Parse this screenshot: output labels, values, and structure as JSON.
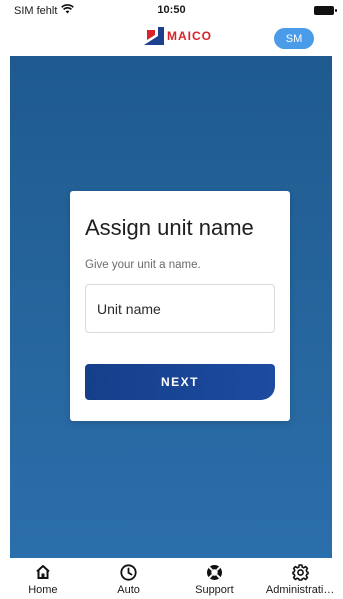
{
  "status_bar": {
    "carrier": "SIM fehlt",
    "time": "10:50"
  },
  "header": {
    "brand": "MAICO",
    "avatar_initials": "SM",
    "avatar_color": "#4a9be8",
    "brand_color": "#d8232a"
  },
  "card": {
    "title": "Assign unit name",
    "subtitle": "Give your unit a name.",
    "input_placeholder": "Unit name",
    "input_value": "",
    "next_label": "NEXT"
  },
  "nav": {
    "items": [
      {
        "label": "Home",
        "icon": "home-icon"
      },
      {
        "label": "Auto",
        "icon": "clock-icon"
      },
      {
        "label": "Support",
        "icon": "lifebuoy-icon"
      },
      {
        "label": "Administrati…",
        "icon": "gear-icon"
      }
    ]
  }
}
